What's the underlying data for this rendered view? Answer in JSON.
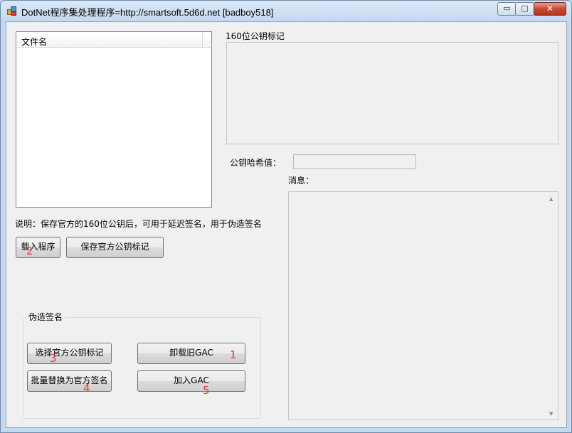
{
  "window": {
    "title": "DotNet程序集处理程序=http://smartsoft.5d6d.net  [badboy518]",
    "controls": {
      "minimize": "▭",
      "maximize": "□",
      "close": "✕"
    }
  },
  "file_list": {
    "column_header": "文件名"
  },
  "public_key": {
    "label": "160位公钥标记",
    "value": ""
  },
  "hash": {
    "label": "公钥哈希值：",
    "value": ""
  },
  "message": {
    "label": "消息：",
    "value": ""
  },
  "note": "说明：保存官方的160位公钥后，可用于延迟签名，用于伪造签名",
  "buttons": {
    "load": "载入程序",
    "save_key": "保存官方公钥标记",
    "select_key": "选择官方公钥标记",
    "uninstall_gac": "卸载旧GAC",
    "batch_replace": "批量替换为官方签名",
    "add_gac": "加入GAC"
  },
  "forge_group": {
    "title": "伪造签名"
  },
  "annotations": {
    "uninstall_gac": "1",
    "load": "2",
    "select_key": "3",
    "batch_replace": "4",
    "add_gac": "5"
  },
  "colors": {
    "annotation": "#e8383d",
    "window_frame": "#c4d8ef",
    "client_bg": "#f0f0f0"
  }
}
